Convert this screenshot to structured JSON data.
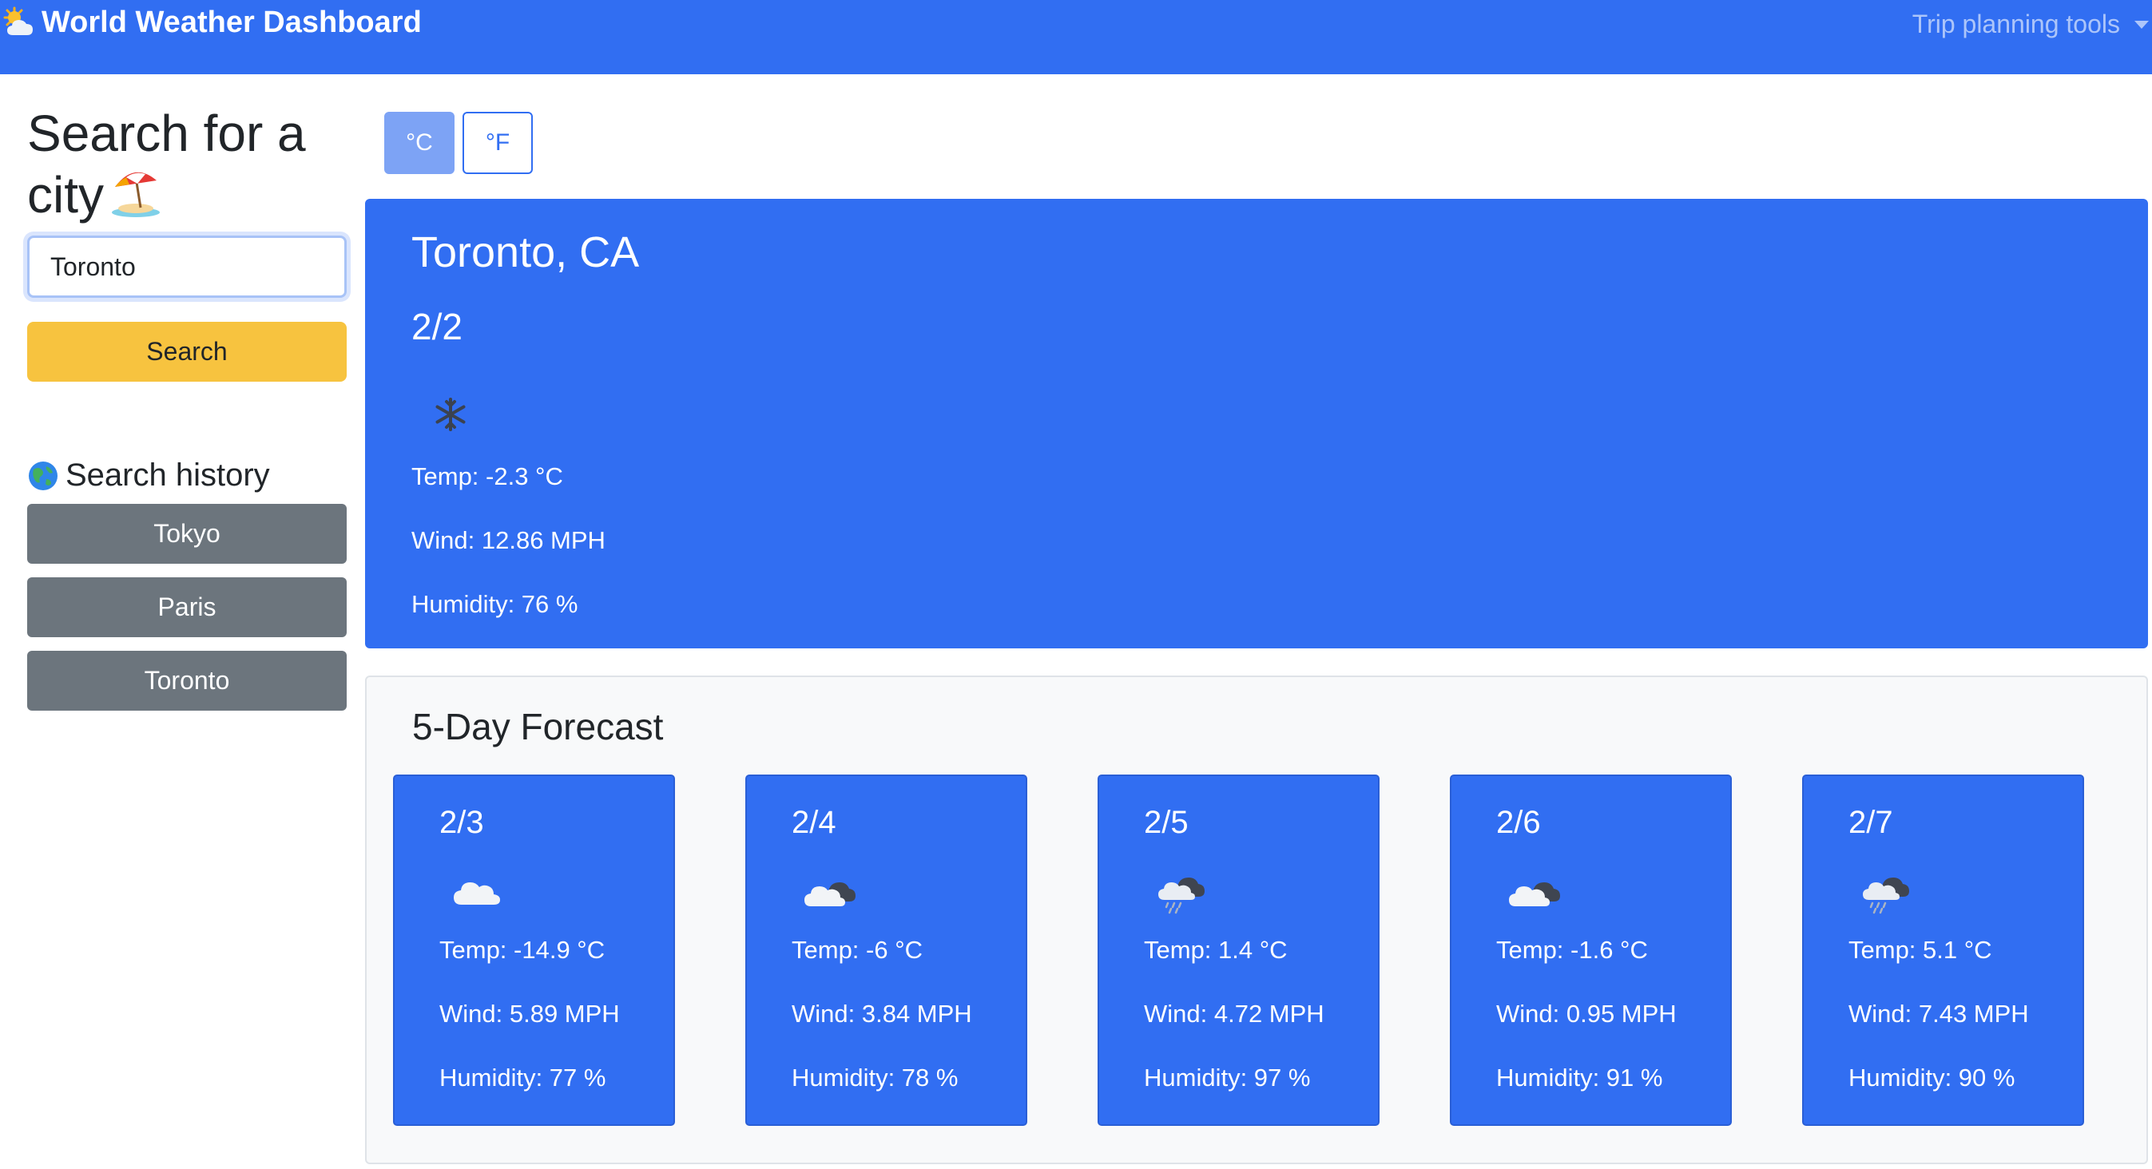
{
  "navbar": {
    "brand": "World Weather Dashboard",
    "brand_icon": "sun-behind-cloud-icon",
    "tools_label": "Trip planning tools"
  },
  "sidebar": {
    "search_title": "Search for a city",
    "search_title_icon": "beach-umbrella-icon",
    "search_value": "Toronto",
    "search_button": "Search",
    "history_title": "Search history",
    "history_icon": "globe-icon",
    "history": [
      "Tokyo",
      "Paris",
      "Toronto"
    ]
  },
  "units": {
    "celsius": "°C",
    "fahrenheit": "°F",
    "selected": "°C"
  },
  "current": {
    "city": "Toronto, CA",
    "date": "2/2",
    "icon": "snowflake-icon",
    "temp": "Temp: -2.3 °C",
    "wind": "Wind: 12.86 MPH",
    "humidity": "Humidity: 76 %"
  },
  "forecast": {
    "title": "5-Day Forecast",
    "days": [
      {
        "date": "2/3",
        "icon": "cloud-icon",
        "temp": "Temp: -14.9 °C",
        "wind": "Wind: 5.89 MPH",
        "humidity": "Humidity: 77 %"
      },
      {
        "date": "2/4",
        "icon": "broken-clouds-icon",
        "temp": "Temp: -6 °C",
        "wind": "Wind: 3.84 MPH",
        "humidity": "Humidity: 78 %"
      },
      {
        "date": "2/5",
        "icon": "rain-cloud-icon",
        "temp": "Temp: 1.4 °C",
        "wind": "Wind: 4.72 MPH",
        "humidity": "Humidity: 97 %"
      },
      {
        "date": "2/6",
        "icon": "broken-clouds-icon",
        "temp": "Temp: -1.6 °C",
        "wind": "Wind: 0.95 MPH",
        "humidity": "Humidity: 91 %"
      },
      {
        "date": "2/7",
        "icon": "rain-cloud-icon",
        "temp": "Temp: 5.1 °C",
        "wind": "Wind: 7.43 MPH",
        "humidity": "Humidity: 90 %"
      }
    ]
  },
  "colors": {
    "primary": "#316ef2",
    "warning": "#f7c33f",
    "secondary": "#6c757d",
    "light": "#f8f9fa"
  }
}
